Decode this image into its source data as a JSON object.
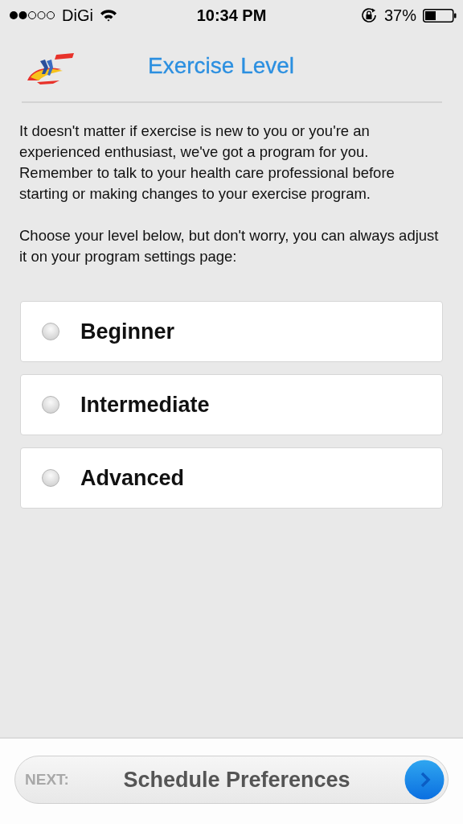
{
  "status_bar": {
    "carrier": "DiGi",
    "time": "10:34 PM",
    "battery": "37%"
  },
  "header": {
    "title": "Exercise Level"
  },
  "intro": "It doesn't matter if exercise is new to you or you're an experienced enthusiast, we've got a program for you. Remember to talk to your health care professional before starting or making changes to your exercise program.",
  "prompt": "Choose your level below, but don't worry, you can always adjust it on your program settings page:",
  "options": [
    {
      "label": "Beginner",
      "selected": false
    },
    {
      "label": "Intermediate",
      "selected": false
    },
    {
      "label": "Advanced",
      "selected": false
    }
  ],
  "next_button": {
    "prefix": "NEXT:",
    "label": "Schedule Preferences"
  }
}
